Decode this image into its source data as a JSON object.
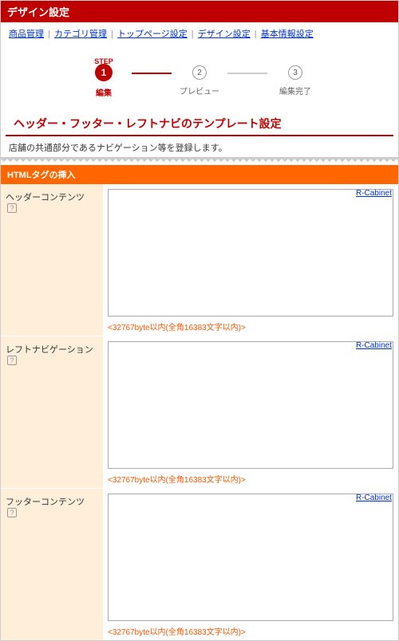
{
  "title": "デザイン設定",
  "breadcrumbs": {
    "items": [
      "商品管理",
      "カテゴリ管理",
      "トップページ設定",
      "デザイン設定",
      "基本情報設定"
    ],
    "sep": " | "
  },
  "stepper": {
    "step_label": "STEP",
    "steps": [
      {
        "num": "1",
        "name": "編集"
      },
      {
        "num": "2",
        "name": "プレビュー"
      },
      {
        "num": "3",
        "name": "編集完了"
      }
    ]
  },
  "section": {
    "heading": "ヘッダー・フッター・レフトナビのテンプレート設定",
    "desc": "店舗の共通部分であるナビゲーション等を登録します。"
  },
  "orange_header": "HTMLタグの挿入",
  "rows": {
    "header": {
      "label": "ヘッダーコンテンツ",
      "note": "<32767byte以内(全角16383文字以内)>"
    },
    "leftnav": {
      "label": "レフトナビゲーション",
      "note": "<32767byte以内(全角16383文字以内)>"
    },
    "footer": {
      "label": "フッターコンテンツ",
      "note": "<32767byte以内(全角16383文字以内)>"
    }
  },
  "cabinet_label": "R-Cabinet",
  "help_icon": "?"
}
